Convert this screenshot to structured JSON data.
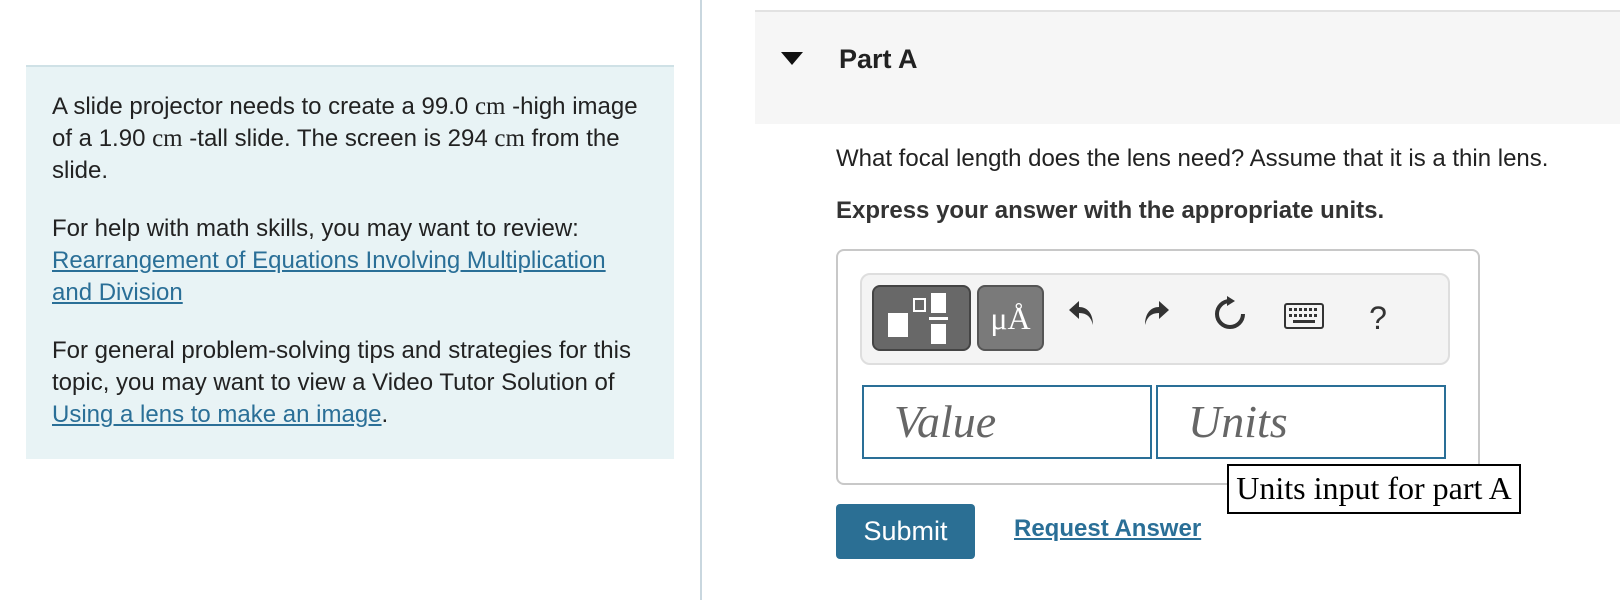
{
  "problem": {
    "statement": {
      "part1": "A slide projector needs to create a 99.0 ",
      "unit1": "cm",
      "part2": " -high image of a 1.90 ",
      "unit2": "cm",
      "part3": " -tall slide. The screen is 294 ",
      "unit3": "cm",
      "part4": " from the slide."
    },
    "help_intro": "For help with math skills, you may want to review:",
    "help_link": "Rearrangement of Equations Involving Multiplication and Division",
    "tips_text": "For general problem-solving tips and strategies for this topic, you may want to view a Video Tutor Solution of ",
    "tips_link": "Using a lens to make an image",
    "tips_end": "."
  },
  "part": {
    "title": "Part A",
    "question": "What focal length does the lens need? Assume that it is a thin lens.",
    "instruction": "Express your answer with the appropriate units."
  },
  "toolbar": {
    "units_label": "μÅ",
    "undo_icon": "undo-icon",
    "redo_icon": "redo-icon",
    "reset_icon": "reset-icon",
    "keyboard_icon": "keyboard-icon",
    "help_label": "?"
  },
  "inputs": {
    "value_placeholder": "Value",
    "units_placeholder": "Units"
  },
  "tooltip": "Units input for part A",
  "actions": {
    "submit": "Submit",
    "request": "Request Answer"
  }
}
